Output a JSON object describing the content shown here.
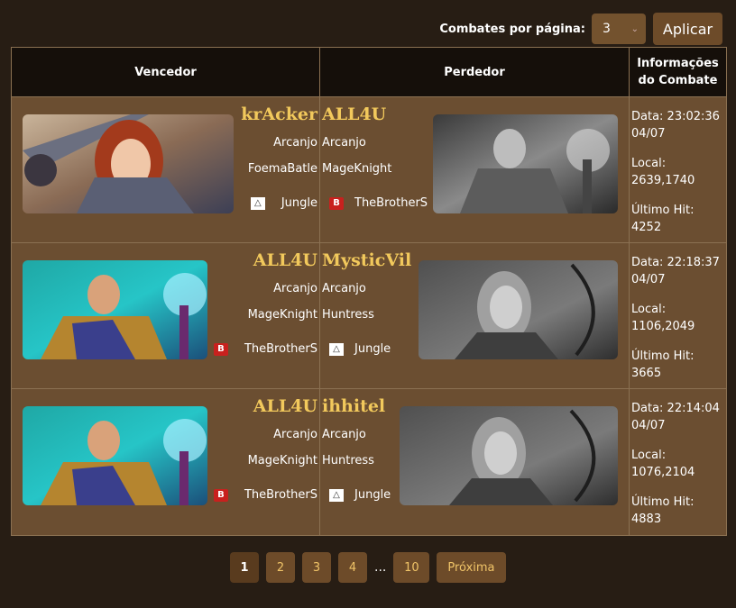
{
  "controls": {
    "per_page_label": "Combates por página:",
    "per_page_value": "3",
    "apply_label": "Aplicar"
  },
  "table": {
    "headers": {
      "winner": "Vencedor",
      "loser": "Perdedor",
      "info_line1": "Informações",
      "info_line2": "do Combate"
    }
  },
  "battles": [
    {
      "winner": {
        "name": "krAcker",
        "class": "Arcanjo",
        "spec": "FoemaBatle",
        "guild": "Jungle",
        "guild_icon": "jungle-guild-icon",
        "portrait": "female-warrior-portrait"
      },
      "loser": {
        "name": "ALL4U",
        "class": "Arcanjo",
        "spec": "MageKnight",
        "guild": "TheBrotherS",
        "guild_icon": "brothers-guild-icon",
        "portrait": "mage-knight-portrait"
      },
      "date_time": "Data: 23:02:36",
      "date_day": "04/07",
      "location_label": "Local:",
      "location": "2639,1740",
      "last_hit_label": "Último Hit:",
      "last_hit": "4252"
    },
    {
      "winner": {
        "name": "ALL4U",
        "class": "Arcanjo",
        "spec": "MageKnight",
        "guild": "TheBrotherS",
        "guild_icon": "brothers-guild-icon",
        "portrait": "mage-knight-portrait"
      },
      "loser": {
        "name": "MysticVil",
        "class": "Arcanjo",
        "spec": "Huntress",
        "guild": "Jungle",
        "guild_icon": "jungle-guild-icon",
        "portrait": "huntress-portrait"
      },
      "date_time": "Data: 22:18:37",
      "date_day": "04/07",
      "location_label": "Local:",
      "location": "1106,2049",
      "last_hit_label": "Último Hit:",
      "last_hit": "3665"
    },
    {
      "winner": {
        "name": "ALL4U",
        "class": "Arcanjo",
        "spec": "MageKnight",
        "guild": "TheBrotherS",
        "guild_icon": "brothers-guild-icon",
        "portrait": "mage-knight-portrait"
      },
      "loser": {
        "name": "ihhitel",
        "class": "Arcanjo",
        "spec": "Huntress",
        "guild": "Jungle",
        "guild_icon": "jungle-guild-icon",
        "portrait": "huntress-portrait"
      },
      "date_time": "Data: 22:14:04",
      "date_day": "04/07",
      "location_label": "Local:",
      "location": "1076,2104",
      "last_hit_label": "Último Hit:",
      "last_hit": "4883"
    }
  ],
  "pagination": {
    "pages": [
      "1",
      "2",
      "3",
      "4"
    ],
    "current": "1",
    "ellipsis": "...",
    "last": "10",
    "next_label": "Próxima"
  },
  "colors": {
    "background": "#271d14",
    "row_bg": "#6b4e31",
    "header_bg": "#150f0a",
    "player_name": "#f2c95c",
    "button_bg": "#6d4b29"
  }
}
